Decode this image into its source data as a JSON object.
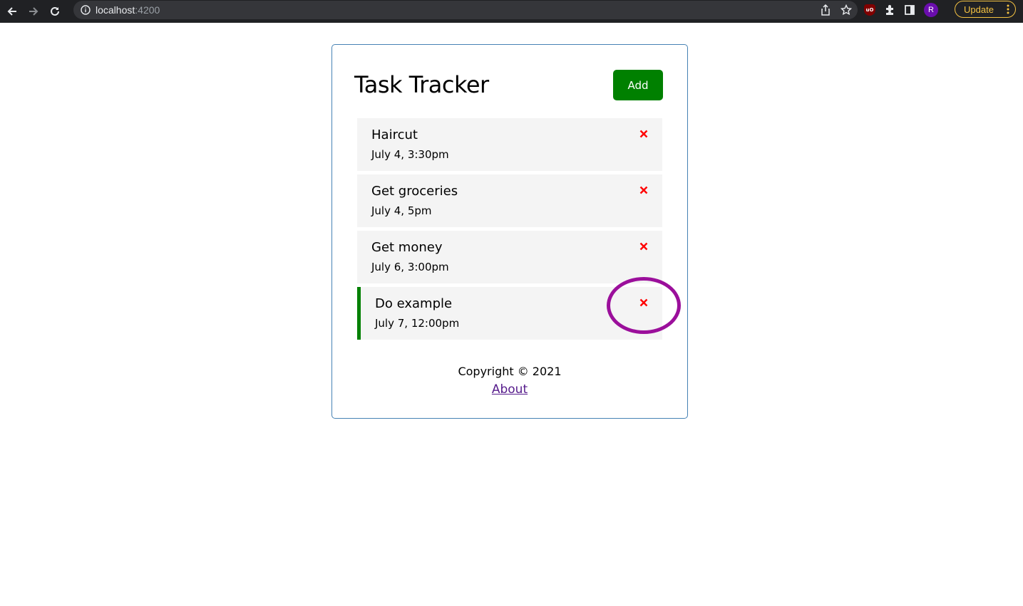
{
  "browser": {
    "url_host": "localhost",
    "url_port": ":4200",
    "profile_initial": "R",
    "update_label": "Update",
    "ublock_badge": "uO"
  },
  "app": {
    "title": "Task Tracker",
    "add_label": "Add",
    "tasks": [
      {
        "text": "Haircut",
        "day": "July 4, 3:30pm",
        "reminder": false
      },
      {
        "text": "Get groceries",
        "day": "July 4, 5pm",
        "reminder": false
      },
      {
        "text": "Get money",
        "day": "July 6, 3:00pm",
        "reminder": false
      },
      {
        "text": "Do example",
        "day": "July 7, 12:00pm",
        "reminder": true
      }
    ],
    "footer": {
      "copyright": "Copyright © 2021",
      "about_label": "About"
    }
  },
  "colors": {
    "accent_green": "#008000",
    "delete_red": "#ff0000",
    "highlight_ring": "#9b0f9b",
    "container_border": "#4682b4",
    "update_yellow": "#f4c242"
  }
}
